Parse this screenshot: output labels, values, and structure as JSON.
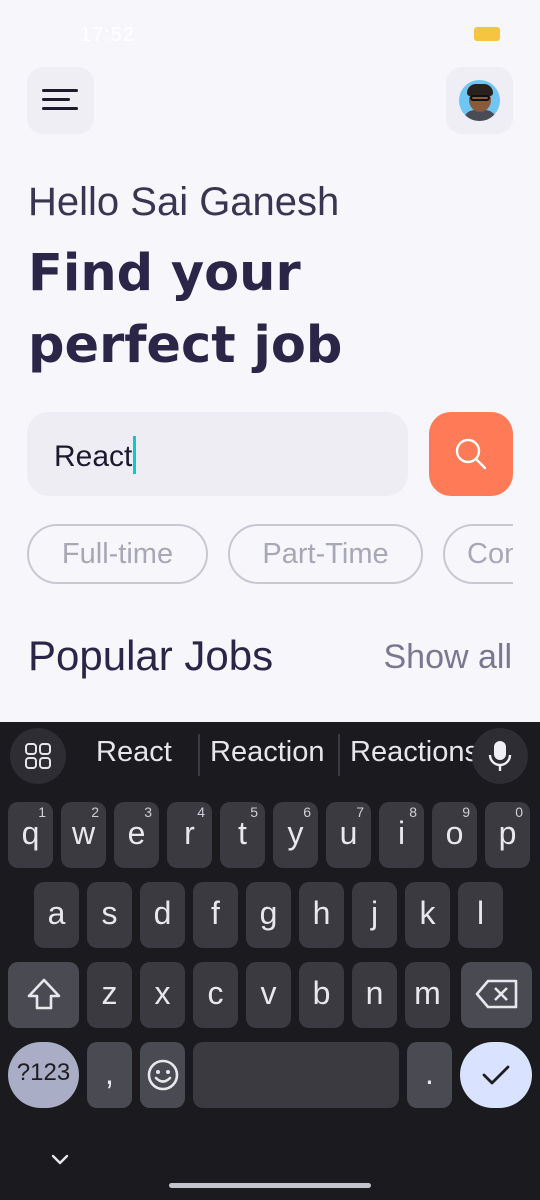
{
  "status_bar": {
    "time": "17:52",
    "battery_level": "5"
  },
  "header": {
    "menu_icon": "hamburger-menu-icon",
    "avatar_icon": "user-avatar-icon"
  },
  "greeting": "Hello Sai Ganesh",
  "title": "Find your perfect job",
  "search": {
    "value": "React",
    "button_icon": "search-icon"
  },
  "chips": [
    "Full-time",
    "Part-Time",
    "Con"
  ],
  "section": {
    "title": "Popular Jobs",
    "action": "Show all"
  },
  "keyboard": {
    "suggestions": [
      "React",
      "Reaction",
      "Reactions"
    ],
    "row1": [
      {
        "key": "q",
        "hint": "1"
      },
      {
        "key": "w",
        "hint": "2"
      },
      {
        "key": "e",
        "hint": "3"
      },
      {
        "key": "r",
        "hint": "4"
      },
      {
        "key": "t",
        "hint": "5"
      },
      {
        "key": "y",
        "hint": "6"
      },
      {
        "key": "u",
        "hint": "7"
      },
      {
        "key": "i",
        "hint": "8"
      },
      {
        "key": "o",
        "hint": "9"
      },
      {
        "key": "p",
        "hint": "0"
      }
    ],
    "row2": [
      "a",
      "s",
      "d",
      "f",
      "g",
      "h",
      "j",
      "k",
      "l"
    ],
    "row3": [
      "z",
      "x",
      "c",
      "v",
      "b",
      "n",
      "m"
    ],
    "mode_key": "?123",
    "comma": ",",
    "period": ".",
    "colors": {
      "background": "#1b1b1f",
      "key": "#3a3a40",
      "enter": "#d9e2ff",
      "mode": "#a9adc6"
    }
  },
  "colors": {
    "accent": "#ff7a56",
    "title": "#2b2548",
    "caret": "#16c6c1"
  }
}
